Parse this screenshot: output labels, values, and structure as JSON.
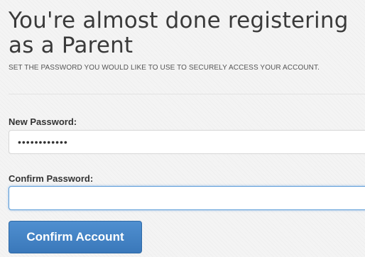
{
  "page": {
    "title": "You're almost done registering as a Parent",
    "subtitle": "SET THE PASSWORD YOU WOULD LIKE TO USE TO SECURELY ACCESS YOUR ACCOUNT."
  },
  "form": {
    "new_password": {
      "label": "New Password:",
      "value": "••••••••••••"
    },
    "confirm_password": {
      "label": "Confirm Password:",
      "value": ""
    },
    "submit_label": "Confirm Account"
  },
  "colors": {
    "button": "#3a78ba",
    "focus_border": "#5a9bd8",
    "text": "#3a3a3a"
  }
}
